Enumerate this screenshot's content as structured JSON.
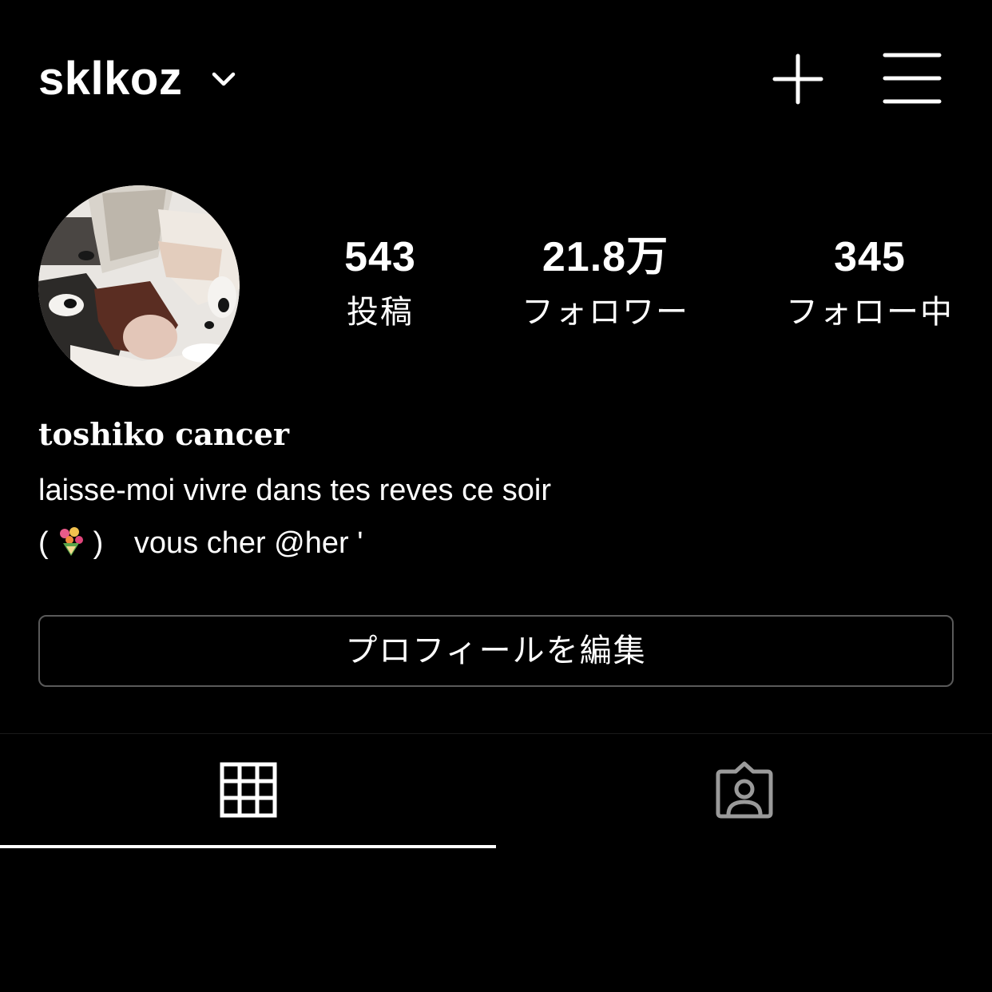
{
  "header": {
    "username": "sklkoz",
    "chevron_icon": "chevron-down-icon",
    "new_post_icon": "plus-icon",
    "menu_icon": "hamburger-menu-icon"
  },
  "profile": {
    "avatar_icon": "profile-photo",
    "stats": [
      {
        "value": "543",
        "label": "投稿"
      },
      {
        "value": "21.8万",
        "label": "フォロワー"
      },
      {
        "value": "345",
        "label": "フォロー中"
      }
    ],
    "display_name": "toshiko cancer",
    "bio": {
      "line1": "laisse-moi vivre dans tes reves ce soir",
      "line2_open": "(",
      "line2_emoji": "bouquet-emoji",
      "line2_close": ")",
      "line2_text": "vous cher @her '"
    },
    "edit_button_label": "プロフィールを編集"
  },
  "tabs": [
    {
      "icon": "grid-icon",
      "active": true
    },
    {
      "icon": "tagged-person-icon",
      "active": false
    }
  ],
  "colors": {
    "background": "#000000",
    "text": "#ffffff",
    "button_border": "#5a5a5a",
    "inactive_icon": "#9a9a9a"
  }
}
